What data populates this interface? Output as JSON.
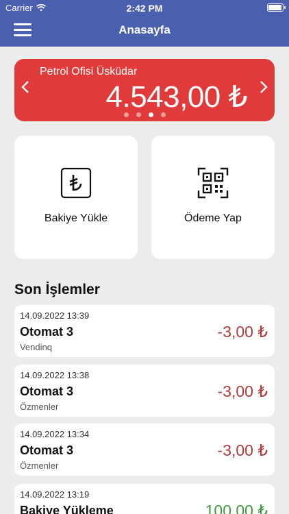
{
  "status": {
    "carrier": "Carrier",
    "time": "2:42 PM",
    "battery_level": 1.0
  },
  "nav": {
    "title": "Anasayfa",
    "menu_icon": "hamburger-icon"
  },
  "card": {
    "station": "Petrol Ofisi Üsküdar",
    "balance": "4.543,00 ₺",
    "page_count": 4,
    "active_page": 3,
    "color": "#e03a3a"
  },
  "actions": [
    {
      "label": "Bakiye Yükle",
      "icon": "lira-icon"
    },
    {
      "label": "Ödeme Yap",
      "icon": "qr-code-icon"
    }
  ],
  "recent": {
    "title": "Son İşlemler",
    "items": [
      {
        "date": "14.09.2022 13:39",
        "title": "Otomat 3",
        "subtitle": "Vendinq",
        "amount": "-3,00 ₺",
        "color": "#b03a3a"
      },
      {
        "date": "14.09.2022 13:38",
        "title": "Otomat 3",
        "subtitle": "Özmenler",
        "amount": "-3,00 ₺",
        "color": "#b03a3a"
      },
      {
        "date": "14.09.2022 13:34",
        "title": "Otomat 3",
        "subtitle": "Özmenler",
        "amount": "-3,00 ₺",
        "color": "#b03a3a"
      },
      {
        "date": "14.09.2022 13:19",
        "title": "Bakiye Yükleme",
        "subtitle": "",
        "amount": "100,00 ₺",
        "color": "#3e9a3e"
      }
    ]
  },
  "colors": {
    "nav": "#4a5fae",
    "background": "#ececec",
    "negative": "#b03a3a",
    "positive": "#3e9a3e"
  }
}
